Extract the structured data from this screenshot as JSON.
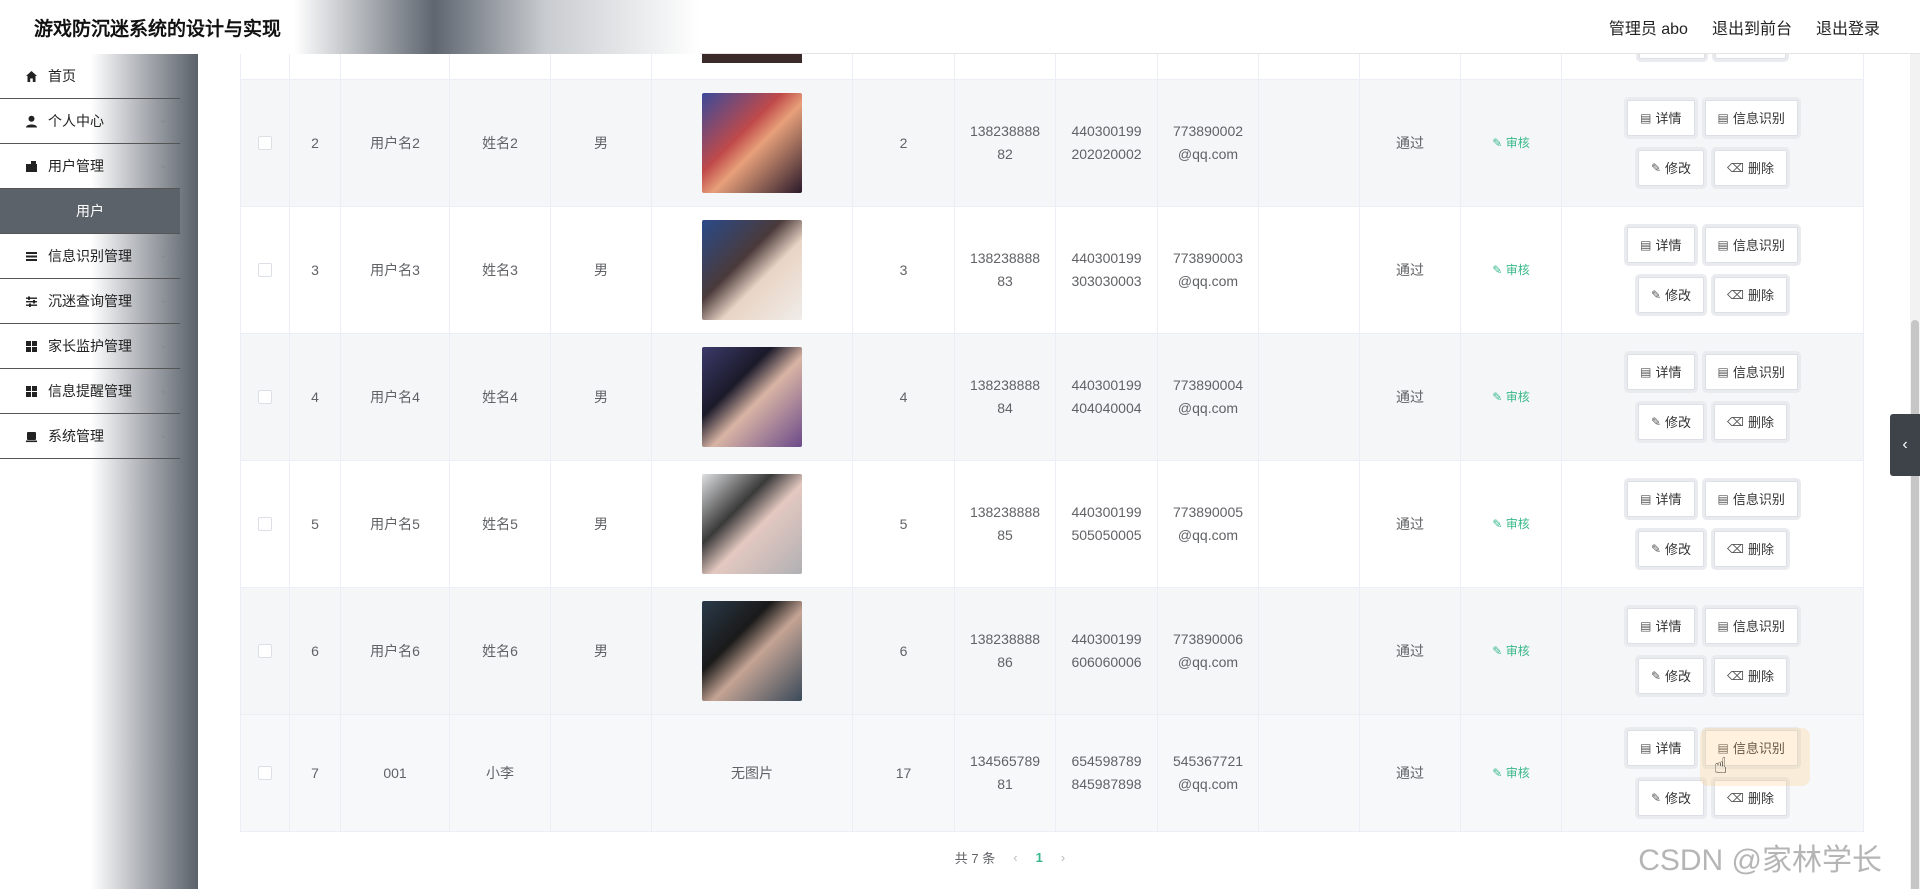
{
  "header": {
    "title": "游戏防沉迷系统的设计与实现",
    "admin": "管理员 abo",
    "front": "退出到前台",
    "logout": "退出登录"
  },
  "sidebar": {
    "items": [
      {
        "label": "首页",
        "icon": "home-icon"
      },
      {
        "label": "个人中心",
        "icon": "user-icon"
      },
      {
        "label": "用户管理",
        "icon": "folder-icon"
      },
      {
        "label": "用户",
        "sub": true
      },
      {
        "label": "信息识别管理",
        "icon": "list-icon"
      },
      {
        "label": "沉迷查询管理",
        "icon": "sliders-icon"
      },
      {
        "label": "家长监护管理",
        "icon": "grid-icon"
      },
      {
        "label": "信息提醒管理",
        "icon": "grid-icon"
      },
      {
        "label": "系统管理",
        "icon": "printer-icon"
      }
    ]
  },
  "table": {
    "rows": [
      {
        "id": "2",
        "username": "用户名2",
        "name": "姓名2",
        "gender": "男",
        "photo": "avatar-2",
        "age": "2",
        "phone_1": "138238888",
        "phone_2": "82",
        "idcard_1": "440300199",
        "idcard_2": "202020002",
        "email_1": "773890002",
        "email_2": "@qq.com",
        "result": "通过",
        "audit": "审核"
      },
      {
        "id": "3",
        "username": "用户名3",
        "name": "姓名3",
        "gender": "男",
        "photo": "avatar-3",
        "age": "3",
        "phone_1": "138238888",
        "phone_2": "83",
        "idcard_1": "440300199",
        "idcard_2": "303030003",
        "email_1": "773890003",
        "email_2": "@qq.com",
        "result": "通过",
        "audit": "审核"
      },
      {
        "id": "4",
        "username": "用户名4",
        "name": "姓名4",
        "gender": "男",
        "photo": "avatar-4",
        "age": "4",
        "phone_1": "138238888",
        "phone_2": "84",
        "idcard_1": "440300199",
        "idcard_2": "404040004",
        "email_1": "773890004",
        "email_2": "@qq.com",
        "result": "通过",
        "audit": "审核"
      },
      {
        "id": "5",
        "username": "用户名5",
        "name": "姓名5",
        "gender": "男",
        "photo": "avatar-5",
        "age": "5",
        "phone_1": "138238888",
        "phone_2": "85",
        "idcard_1": "440300199",
        "idcard_2": "505050005",
        "email_1": "773890005",
        "email_2": "@qq.com",
        "result": "通过",
        "audit": "审核"
      },
      {
        "id": "6",
        "username": "用户名6",
        "name": "姓名6",
        "gender": "男",
        "photo": "avatar-6",
        "age": "6",
        "phone_1": "138238888",
        "phone_2": "86",
        "idcard_1": "440300199",
        "idcard_2": "606060006",
        "email_1": "773890006",
        "email_2": "@qq.com",
        "result": "通过",
        "audit": "审核"
      },
      {
        "id": "7",
        "username": "001",
        "name": "小李",
        "gender": "",
        "photo_text": "无图片",
        "age": "17",
        "phone_1": "134565789",
        "phone_2": "81",
        "idcard_1": "654598789",
        "idcard_2": "845987898",
        "email_1": "545367721",
        "email_2": "@qq.com",
        "result": "通过",
        "audit": "审核"
      }
    ],
    "actions": {
      "detail": "详情",
      "recognize": "信息识别",
      "edit": "修改",
      "delete": "删除",
      "top_partial": "修改"
    }
  },
  "pager": {
    "total": "共 7 条",
    "current": "1",
    "prev": "‹",
    "next": "›"
  },
  "watermark": "CSDN @家林学长",
  "colors": {
    "accent": "#3ab98a",
    "sidebar_active": "#5b626a"
  }
}
